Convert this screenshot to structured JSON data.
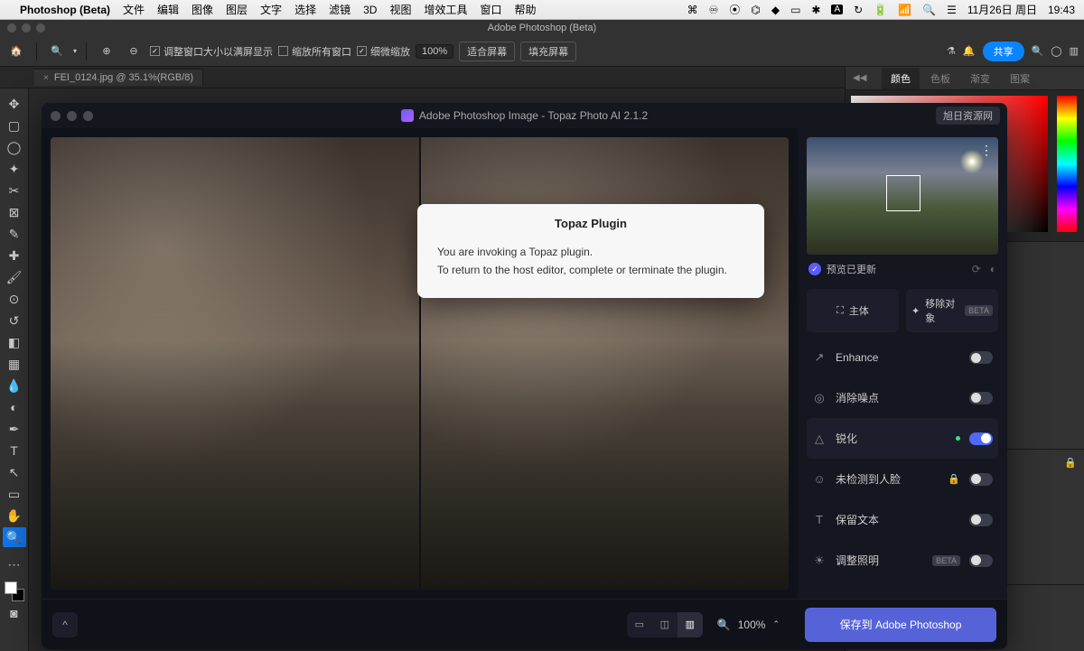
{
  "macos": {
    "app_name": "Photoshop (Beta)",
    "menus": [
      "文件",
      "编辑",
      "图像",
      "图层",
      "文字",
      "选择",
      "滤镜",
      "3D",
      "视图",
      "增效工具",
      "窗口",
      "帮助"
    ],
    "date": "11月26日 周日",
    "time": "19:43"
  },
  "ps": {
    "window_title": "Adobe Photoshop (Beta)",
    "options": {
      "cb1": "调整窗口大小以满屏显示",
      "cb2": "缩放所有窗口",
      "cb3": "细微缩放",
      "zoom": "100%",
      "fit": "适合屏幕",
      "fill": "填充屏幕"
    },
    "share": "共享",
    "tab": "FEI_0124.jpg @ 35.1%(RGB/8)",
    "right_tabs": [
      "颜色",
      "色板",
      "渐变",
      "图案"
    ]
  },
  "topaz": {
    "title": "Adobe Photoshop Image - Topaz Photo AI 2.1.2",
    "corner_badge": "旭日资源网",
    "status": "预览已更新",
    "tabs": {
      "subject": "主体",
      "remove": "移除对象",
      "remove_badge": "BETA"
    },
    "opts": {
      "enhance": "Enhance",
      "denoise": "消除噪点",
      "sharpen": "锐化",
      "face": "未检测到人脸",
      "text": "保留文本",
      "light": "调整照明",
      "light_badge": "BETA"
    },
    "zoom": "100%",
    "save": "保存到 Adobe Photoshop"
  },
  "modal": {
    "title": "Topaz Plugin",
    "line1": "You are invoking a Topaz plugin.",
    "line2": "To return to the host editor, complete or terminate the plugin."
  }
}
